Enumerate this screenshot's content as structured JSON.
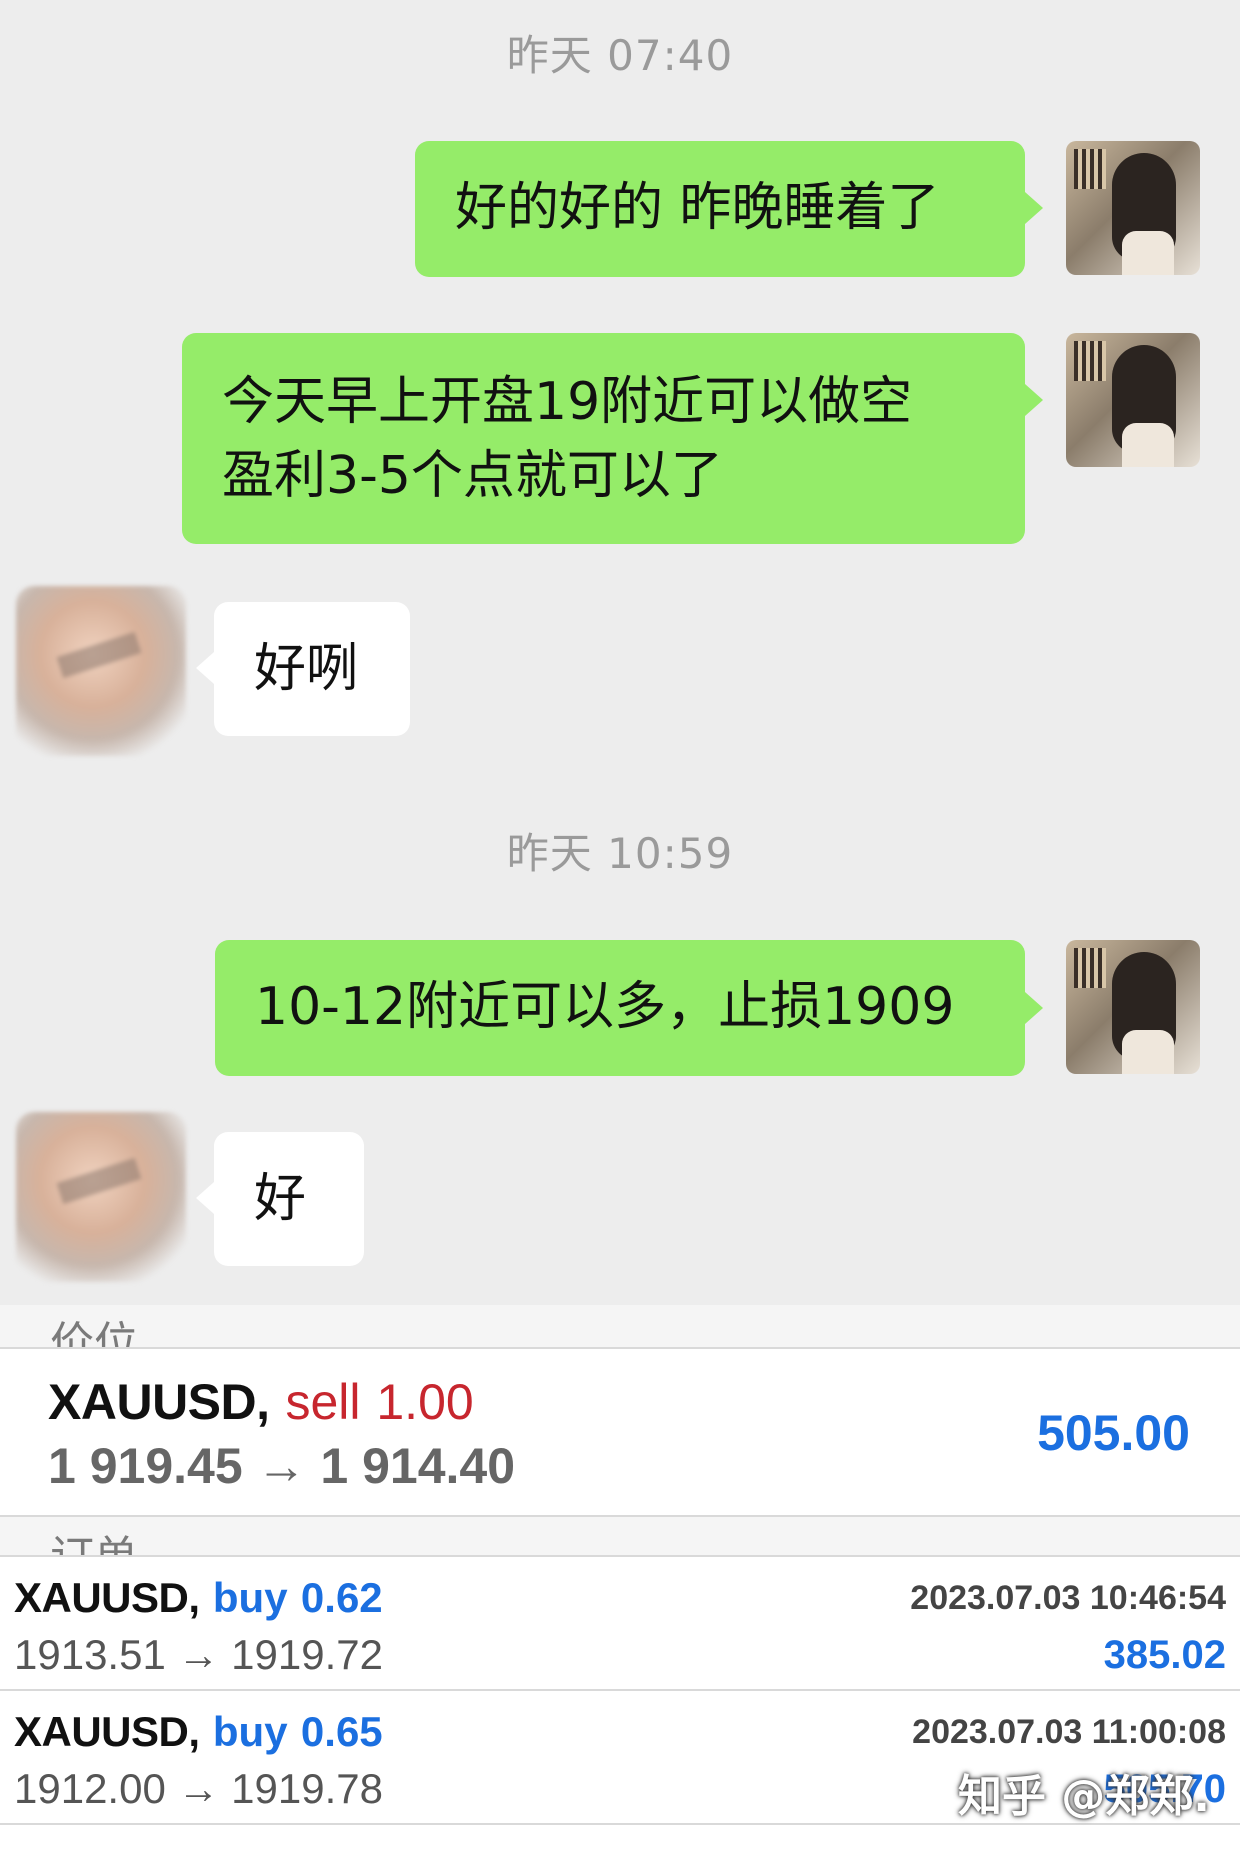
{
  "chat": {
    "timestamps": [
      "昨天 07:40",
      "昨天 10:59"
    ],
    "messages": [
      {
        "sender": "me",
        "text": "好的好的 昨晚睡着了"
      },
      {
        "sender": "me",
        "lines": [
          "今天早上开盘19附近可以做空",
          "盈利3-5个点就可以了"
        ]
      },
      {
        "sender": "other",
        "text": "好咧"
      },
      {
        "sender": "me",
        "text": "10-12附近可以多，止损1909"
      },
      {
        "sender": "other",
        "text": "好"
      }
    ]
  },
  "trades": {
    "position_section_label": "价位",
    "orders_section_label": "订单",
    "position": {
      "symbol": "XAUUSD,",
      "side": "sell",
      "volume": "1.00",
      "prices": "1 919.45 → 1 914.40",
      "profit": "505.00"
    },
    "orders": [
      {
        "symbol": "XAUUSD,",
        "side": "buy",
        "volume": "0.62",
        "prices": "1913.51 → 1919.72",
        "time": "2023.07.03 10:46:54",
        "profit": "385.02"
      },
      {
        "symbol": "XAUUSD,",
        "side": "buy",
        "volume": "0.65",
        "prices": "1912.00 → 1919.78",
        "time": "2023.07.03 11:00:08",
        "profit": "505.70"
      }
    ]
  },
  "watermark": "知乎 @郑郑.",
  "colors": {
    "chat_bg": "#ededed",
    "my_bubble": "#95ec69",
    "other_bubble": "#ffffff",
    "sell": "#c7262e",
    "buy": "#1b6fe0",
    "profit": "#1b6fe0"
  }
}
